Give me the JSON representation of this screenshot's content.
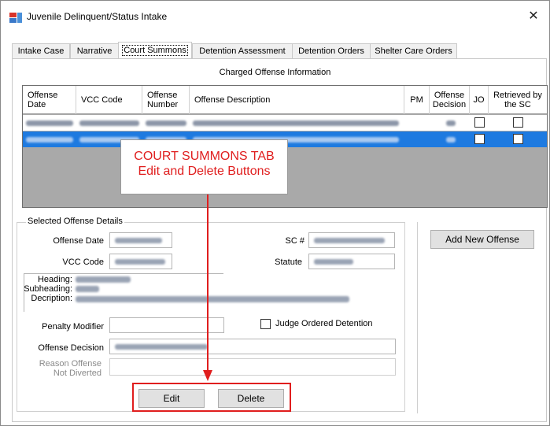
{
  "window": {
    "title": "Juvenile Delinquent/Status Intake",
    "close_glyph": "✕"
  },
  "tabs": [
    {
      "label": "Intake Case"
    },
    {
      "label": "Narrative"
    },
    {
      "label": "Court Summons"
    },
    {
      "label": "Detention Assessment"
    },
    {
      "label": "Detention Orders"
    },
    {
      "label": "Shelter Care Orders"
    }
  ],
  "grid": {
    "caption": "Charged Offense Information",
    "columns": [
      {
        "label": "Offense Date"
      },
      {
        "label": "VCC Code"
      },
      {
        "label": "Offense Number"
      },
      {
        "label": "Offense Description"
      },
      {
        "label": "PM"
      },
      {
        "label": "Offense Decision"
      },
      {
        "label": "JO"
      },
      {
        "label": "Retrieved by the SC"
      }
    ],
    "rows": [
      {
        "selected": false,
        "jo_checked": false,
        "retrieved_checked": false
      },
      {
        "selected": true,
        "jo_checked": false,
        "retrieved_checked": false
      }
    ],
    "selected_row_color": "#1e7ae0",
    "empty_area_color": "#a9a9a9"
  },
  "annotation": {
    "line1": "COURT SUMMONS TAB",
    "line2": "Edit and Delete Buttons",
    "color": "#e01e1e"
  },
  "details": {
    "legend": "Selected Offense Details",
    "offense_date_label": "Offense Date",
    "sc_label": "SC #",
    "vcc_code_label": "VCC Code",
    "statute_label": "Statute",
    "heading_label": "Heading:",
    "subheading_label": "Subheading:",
    "description_label": "Decription:",
    "penalty_modifier_label": "Penalty Modifier",
    "judge_ordered_label": "Judge Ordered Detention",
    "offense_decision_label": "Offense Decision",
    "reason_label_line1": "Reason Offense",
    "reason_label_line2": "Not Diverted"
  },
  "buttons": {
    "add_new_offense": "Add New Offense",
    "edit": "Edit",
    "delete": "Delete"
  }
}
